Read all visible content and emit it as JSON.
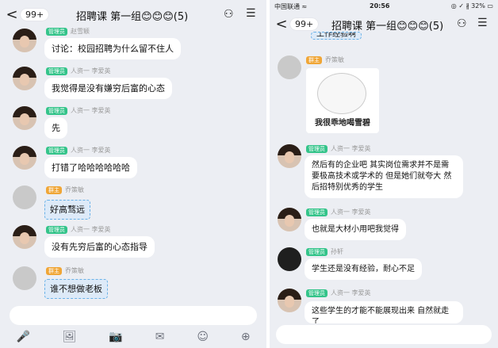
{
  "left": {
    "header": {
      "back": "<",
      "count": "99+",
      "title": "招聘课 第一组😊😊😊(5)"
    },
    "messages": [
      {
        "role": "管理员",
        "name": "赵雪颖",
        "text": "讨论：校园招聘为什么留不住人",
        "highlight": false,
        "avatar": "female"
      },
      {
        "role": "管理员",
        "name": "人资一 李爱英",
        "text": "我觉得是没有嫌穷后富的心态",
        "highlight": false,
        "avatar": "female"
      },
      {
        "role": "管理员",
        "name": "人资一 李爱英",
        "text": "先",
        "highlight": false,
        "avatar": "female"
      },
      {
        "role": "管理员",
        "name": "人资一 李爱英",
        "text": "打错了哈哈哈哈哈哈",
        "highlight": false,
        "avatar": "female"
      },
      {
        "role": "群主",
        "name": "乔策敏",
        "text": "好高骛远",
        "highlight": true,
        "avatar": "grey"
      },
      {
        "role": "管理员",
        "name": "人资一 李爱英",
        "text": "没有先穷后富的心态指导",
        "highlight": false,
        "avatar": "female"
      },
      {
        "role": "群主",
        "name": "乔策敏",
        "text": "谁不想做老板",
        "highlight": true,
        "avatar": "grey"
      }
    ],
    "toolbar": [
      "🎤",
      "🖼",
      "📷",
      "✉",
      "☺",
      "⊕"
    ]
  },
  "right": {
    "status": {
      "carrier": "中国联通 ≈",
      "time": "20:56",
      "battery": "◎ ✓ ∦ 32% ▭"
    },
    "header": {
      "back": "<",
      "count": "99+",
      "title": "招聘课 第一组😊😊😊(5)"
    },
    "top_partial": "工作经验啊",
    "sticker": {
      "role": "群主",
      "name": "乔策敏",
      "caption": "我很乖地喝雪碧"
    },
    "messages": [
      {
        "role": "管理员",
        "name": "人资一 李爱英",
        "text": "然后有的企业吧 其实岗位需求并不是需要极高技术或学术的 但是她们就夸大 然后招特别优秀的学生",
        "avatar": "female"
      },
      {
        "role": "管理员",
        "name": "人资一 李爱英",
        "text": "也就是大材小用吧我觉得",
        "avatar": "female"
      },
      {
        "role": "管理员",
        "name": "孙轩",
        "text": "学生还是没有经验，耐心不足",
        "avatar": "dark"
      },
      {
        "role": "管理员",
        "name": "人资一 李爱英",
        "text": "这些学生的才能不能展现出来 自然就走了",
        "avatar": "female"
      }
    ]
  }
}
